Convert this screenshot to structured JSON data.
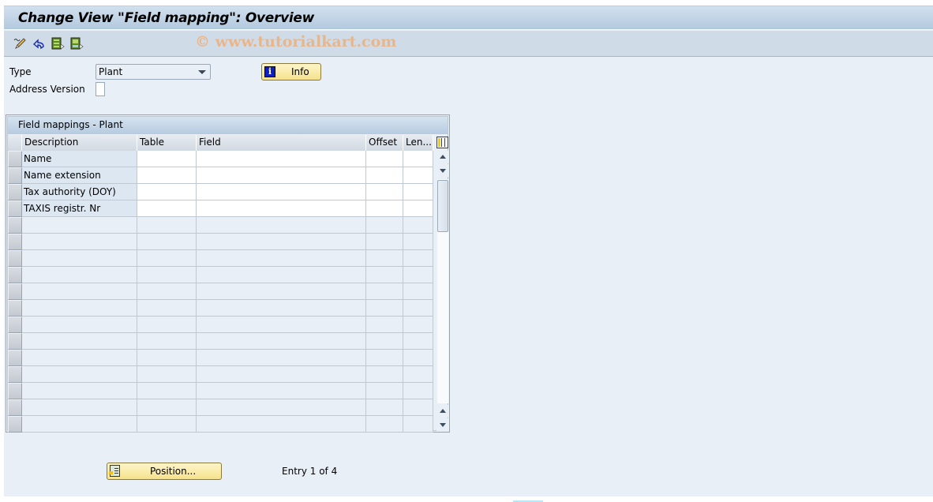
{
  "window": {
    "title": "Change View \"Field mapping\": Overview"
  },
  "toolbar": {
    "icons": [
      {
        "name": "display-change-icon",
        "tooltip": "Display/Change"
      },
      {
        "name": "undo-icon",
        "tooltip": "Undo"
      },
      {
        "name": "select-all-icon",
        "tooltip": "Select All"
      },
      {
        "name": "select-block-icon",
        "tooltip": "Select Block"
      }
    ],
    "watermark": "© www.tutorialkart.com"
  },
  "form": {
    "type_label": "Type",
    "type_value": "Plant",
    "address_version_label": "Address Version",
    "address_version_checked": false,
    "info_button": "Info",
    "info_icon": "info-icon"
  },
  "table": {
    "title": "Field mappings - Plant",
    "columns": [
      "Description",
      "Table",
      "Field",
      "Offset",
      "Len..."
    ],
    "rows": [
      {
        "description": "Name",
        "table": "",
        "field": "",
        "offset": "",
        "length": ""
      },
      {
        "description": "Name extension",
        "table": "",
        "field": "",
        "offset": "",
        "length": ""
      },
      {
        "description": "Tax authority (DOY)",
        "table": "",
        "field": "",
        "offset": "",
        "length": ""
      },
      {
        "description": "TAXIS registr. Nr",
        "table": "",
        "field": "",
        "offset": "",
        "length": ""
      }
    ],
    "empty_rows": 13
  },
  "footer": {
    "position_button": "Position...",
    "entry_text": "Entry 1 of 4"
  }
}
